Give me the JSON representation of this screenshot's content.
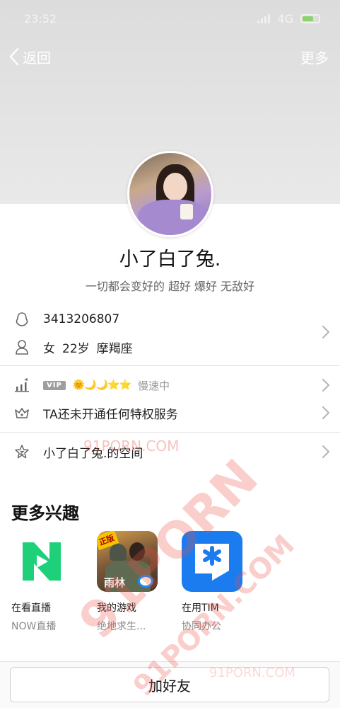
{
  "status_bar": {
    "time": "23:52",
    "network": "4G"
  },
  "nav": {
    "back_label": "返回",
    "more_label": "更多"
  },
  "profile": {
    "nickname": "小了白了兔.",
    "signature": "一切都会变好的 超好 爆好 无敌好",
    "qq_number": "3413206807",
    "gender": "女",
    "age": "22岁",
    "zodiac": "摩羯座"
  },
  "vip": {
    "badge": "VIP",
    "level_icons": "🌞🌙🌙⭐⭐",
    "status": "慢速中"
  },
  "privilege": {
    "text": "TA还未开通任何特权服务"
  },
  "space": {
    "text": "小了白了兔.的空间"
  },
  "interests": {
    "title": "更多兴趣",
    "apps": [
      {
        "name": "在看直播",
        "desc": "NOW直播",
        "icon": "now-live-icon",
        "color": "#1fd07a"
      },
      {
        "name": "我的游戏",
        "desc": "绝地求生...",
        "icon": "game-icon",
        "badge": "正版",
        "brand": "雨林"
      },
      {
        "name": "在用TIM",
        "desc": "协同办公",
        "icon": "tim-icon",
        "color": "#1b7cf0"
      }
    ]
  },
  "actions": {
    "add_friend": "加好友"
  },
  "watermarks": {
    "large": "91PORN",
    "diagonal": "91PORN.COM",
    "small_mid": "91PORN.COM",
    "small_bottom": "91PORN.COM"
  }
}
